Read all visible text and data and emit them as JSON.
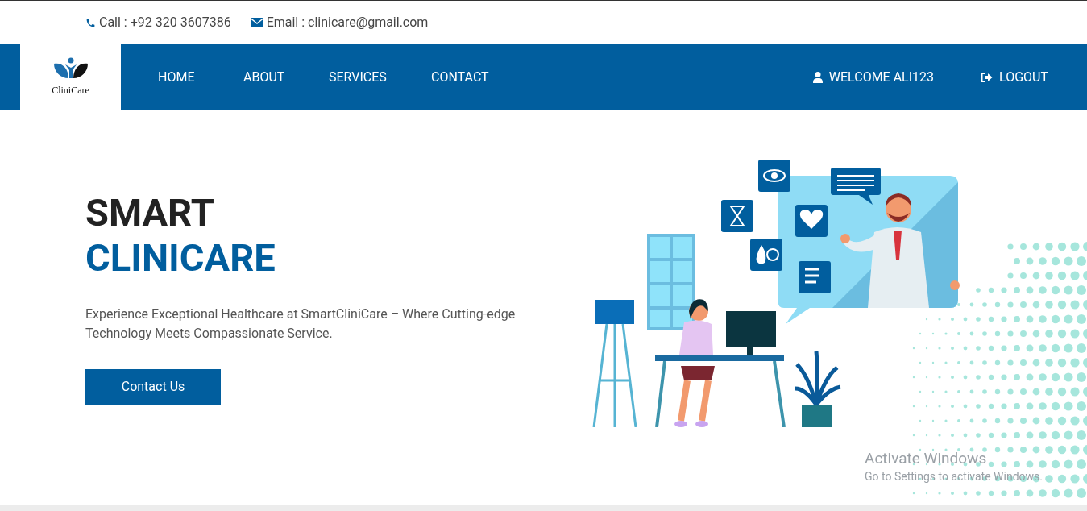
{
  "contact_bar": {
    "phone": "Call : +92 320 3607386",
    "email": "Email : clinicare@gmail.com"
  },
  "navbar": {
    "logo_text": "CliniCare",
    "links": [
      {
        "label": "HOME"
      },
      {
        "label": "ABOUT"
      },
      {
        "label": "SERVICES"
      },
      {
        "label": "CONTACT"
      }
    ],
    "user": "WELCOME ALI123",
    "logout": "LOGOUT"
  },
  "hero": {
    "title_line_1": "SMART",
    "title_line_2": "CLINICARE",
    "description": "Experience Exceptional Healthcare at SmartCliniCare – Where Cutting-edge Technology Meets Compassionate Service.",
    "button": "Contact Us"
  },
  "os_overlay": {
    "title": "Activate Windows",
    "subtitle": "Go to Settings to activate Windows."
  }
}
